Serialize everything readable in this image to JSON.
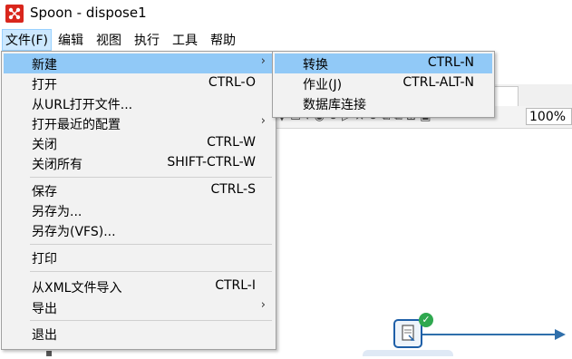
{
  "window": {
    "title": "Spoon - dispose1"
  },
  "menubar": {
    "items": [
      "文件(F)",
      "编辑",
      "视图",
      "执行",
      "工具",
      "帮助"
    ]
  },
  "file_menu": {
    "items": [
      {
        "label": "新建",
        "shortcut": "",
        "submenu": true
      },
      {
        "label": "打开",
        "shortcut": "CTRL-O",
        "submenu": false
      },
      {
        "label": "从URL打开文件...",
        "shortcut": "",
        "submenu": false
      },
      {
        "label": "打开最近的配置",
        "shortcut": "",
        "submenu": true
      },
      {
        "label": "关闭",
        "shortcut": "CTRL-W",
        "submenu": false
      },
      {
        "label": "关闭所有",
        "shortcut": "SHIFT-CTRL-W",
        "submenu": false
      },
      {
        "label": "保存",
        "shortcut": "CTRL-S",
        "submenu": false
      },
      {
        "label": "另存为...",
        "shortcut": "",
        "submenu": false
      },
      {
        "label": "另存为(VFS)...",
        "shortcut": "",
        "submenu": false
      },
      {
        "label": "打印",
        "shortcut": "",
        "submenu": false
      },
      {
        "label": "从XML文件导入",
        "shortcut": "CTRL-I",
        "submenu": false
      },
      {
        "label": "导出",
        "shortcut": "",
        "submenu": true
      },
      {
        "label": "退出",
        "shortcut": "",
        "submenu": false
      }
    ],
    "submenu_arrow": "›"
  },
  "new_submenu": {
    "items": [
      {
        "label": "转换",
        "shortcut": "CTRL-N"
      },
      {
        "label": "作业(J)",
        "shortcut": "CTRL-ALT-N"
      },
      {
        "label": "数据库连接",
        "shortcut": ""
      }
    ]
  },
  "toolbar": {
    "zoom": "100%"
  },
  "canvas": {
    "step_status": "✓"
  },
  "icons": [
    "spoon-app-icon",
    "submenu-arrow-icon",
    "toolbar-icons",
    "transformation-step-icon",
    "success-check-icon"
  ]
}
